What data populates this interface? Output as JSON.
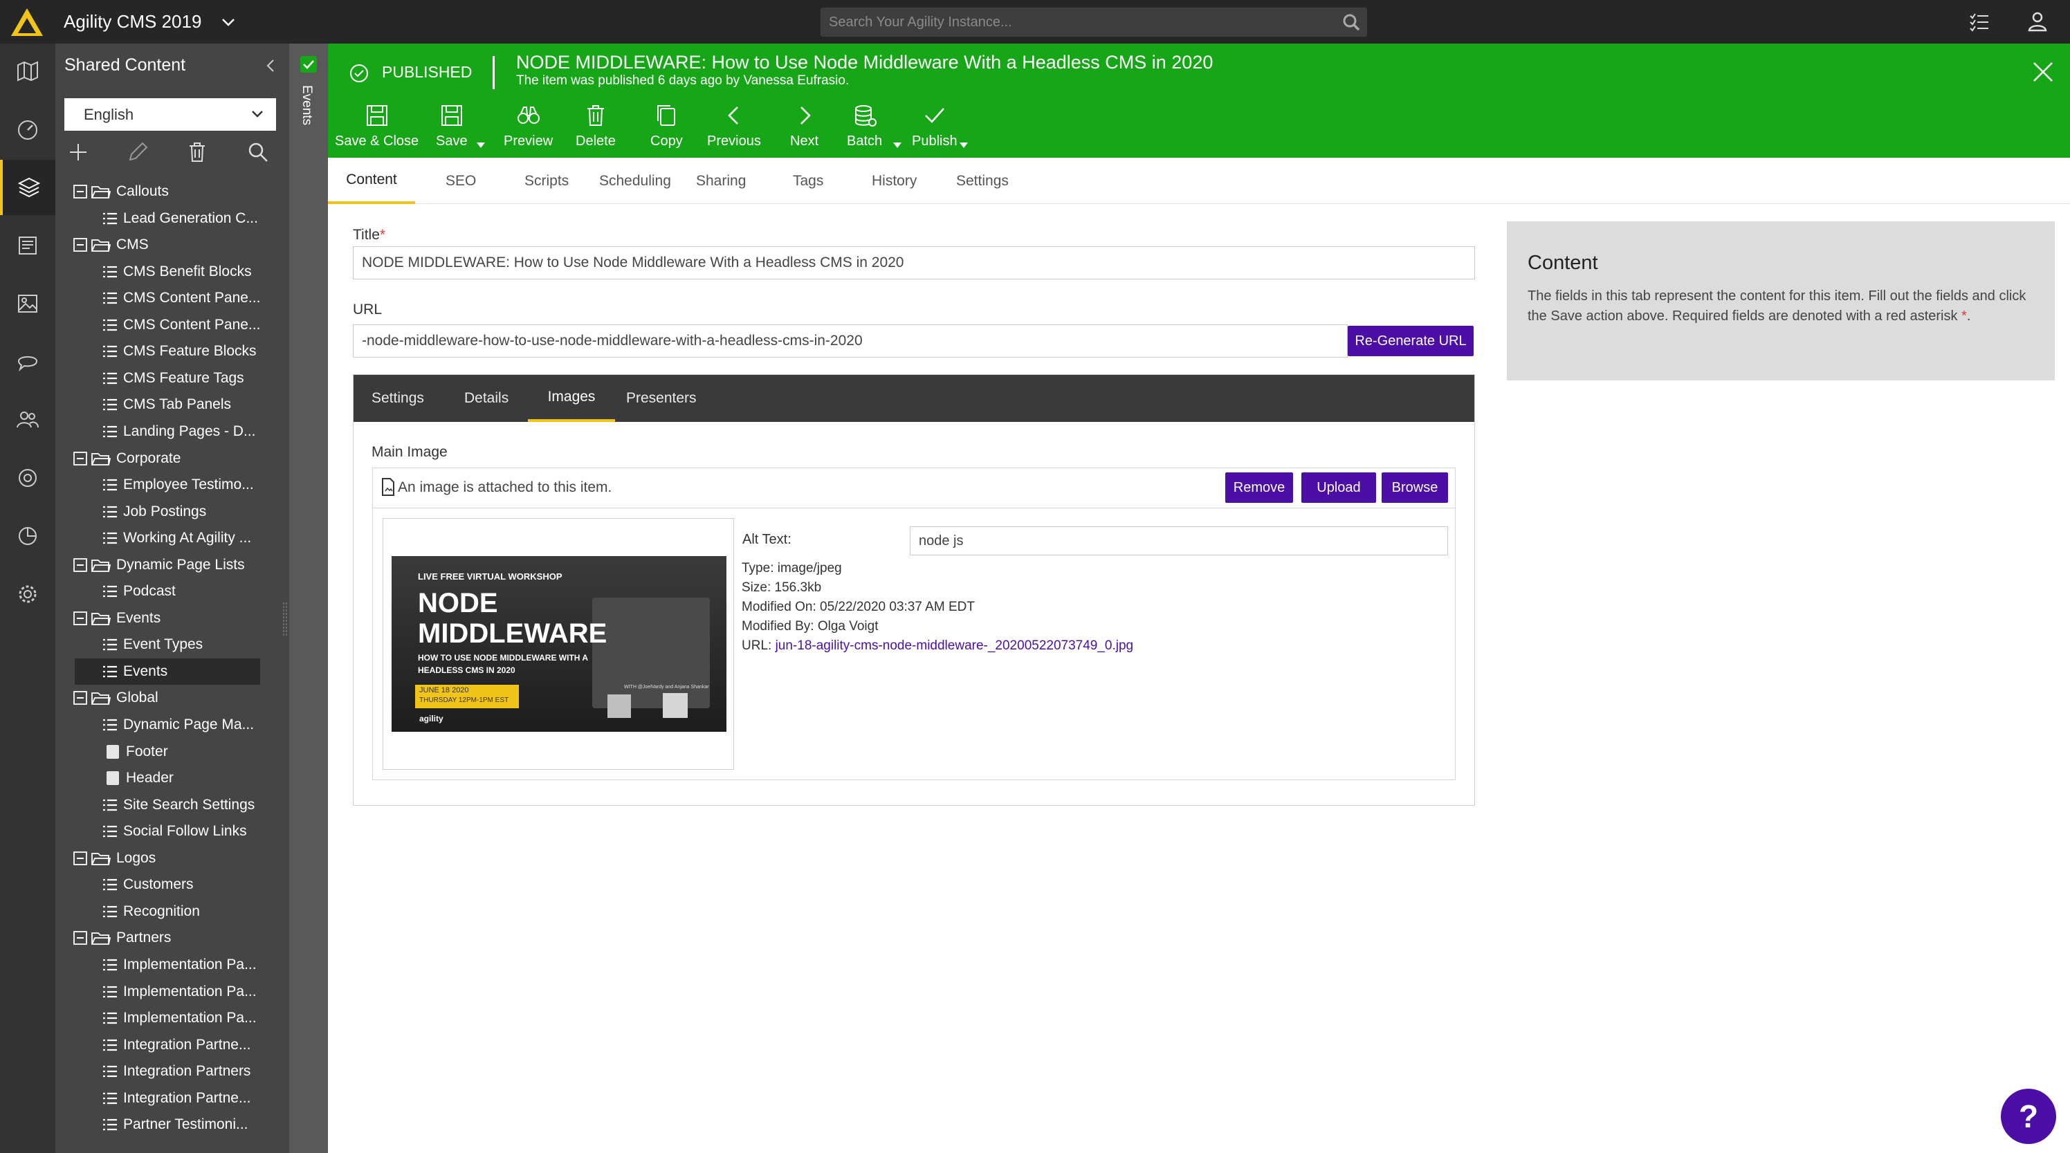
{
  "app": {
    "title": "Agility CMS 2019"
  },
  "search": {
    "placeholder": "Search Your Agility Instance..."
  },
  "tree": {
    "title": "Shared Content",
    "language": "English",
    "nodes": [
      {
        "label": "Callouts",
        "kind": "folder"
      },
      {
        "label": "Lead Generation C...",
        "kind": "list"
      },
      {
        "label": "CMS",
        "kind": "folder"
      },
      {
        "label": "CMS Benefit Blocks",
        "kind": "list"
      },
      {
        "label": "CMS Content Pane...",
        "kind": "list"
      },
      {
        "label": "CMS Content Pane...",
        "kind": "list"
      },
      {
        "label": "CMS Feature Blocks",
        "kind": "list"
      },
      {
        "label": "CMS Feature Tags",
        "kind": "list"
      },
      {
        "label": "CMS Tab Panels",
        "kind": "list"
      },
      {
        "label": "Landing Pages - D...",
        "kind": "list"
      },
      {
        "label": "Corporate",
        "kind": "folder"
      },
      {
        "label": "Employee Testimo...",
        "kind": "list"
      },
      {
        "label": "Job Postings",
        "kind": "list"
      },
      {
        "label": "Working At Agility ...",
        "kind": "list"
      },
      {
        "label": "Dynamic Page Lists",
        "kind": "folder"
      },
      {
        "label": "Podcast",
        "kind": "list"
      },
      {
        "label": "Events",
        "kind": "folder"
      },
      {
        "label": "Event Types",
        "kind": "list"
      },
      {
        "label": "Events",
        "kind": "list",
        "selected": true
      },
      {
        "label": "Global",
        "kind": "folder"
      },
      {
        "label": "Dynamic Page Ma...",
        "kind": "list"
      },
      {
        "label": "Footer",
        "kind": "page"
      },
      {
        "label": "Header",
        "kind": "page"
      },
      {
        "label": "Site Search Settings",
        "kind": "list"
      },
      {
        "label": "Social Follow Links",
        "kind": "list"
      },
      {
        "label": "Logos",
        "kind": "folder"
      },
      {
        "label": "Customers",
        "kind": "list"
      },
      {
        "label": "Recognition",
        "kind": "list"
      },
      {
        "label": "Partners",
        "kind": "folder"
      },
      {
        "label": "Implementation Pa...",
        "kind": "list"
      },
      {
        "label": "Implementation Pa...",
        "kind": "list"
      },
      {
        "label": "Implementation Pa...",
        "kind": "list"
      },
      {
        "label": "Integration Partne...",
        "kind": "list"
      },
      {
        "label": "Integration Partners",
        "kind": "list"
      },
      {
        "label": "Integration Partne...",
        "kind": "list"
      },
      {
        "label": "Partner Testimoni...",
        "kind": "list"
      }
    ]
  },
  "side_strip": {
    "label": "Events"
  },
  "item": {
    "status": "PUBLISHED",
    "title": "NODE MIDDLEWARE: How to Use Node Middleware With a Headless CMS in 2020",
    "subtitle": "The item was published 6 days ago by Vanessa Eufrasio."
  },
  "toolbar": {
    "save_close": "Save & Close",
    "save": "Save",
    "preview": "Preview",
    "delete": "Delete",
    "copy": "Copy",
    "previous": "Previous",
    "next": "Next",
    "batch": "Batch",
    "publish": "Publish"
  },
  "tabs": [
    "Content",
    "SEO",
    "Scripts",
    "Scheduling",
    "Sharing",
    "Tags",
    "History",
    "Settings"
  ],
  "form": {
    "title_label": "Title",
    "title_required": "*",
    "title_value": "NODE MIDDLEWARE: How to Use Node Middleware With a Headless CMS in 2020",
    "url_label": "URL",
    "url_value": "-node-middleware-how-to-use-node-middleware-with-a-headless-cms-in-2020",
    "regen_label": "Re-Generate URL"
  },
  "inner_tabs": [
    "Settings",
    "Details",
    "Images",
    "Presenters"
  ],
  "image_field": {
    "label": "Main Image",
    "attached_text": "An image is attached to this item.",
    "remove": "Remove",
    "upload": "Upload",
    "browse": "Browse",
    "alt_label": "Alt Text:",
    "alt_value": "node js",
    "type_label": "Type:",
    "type_value": "image/jpeg",
    "size_label": "Size:",
    "size_value": "156.3kb",
    "modified_on_label": "Modified On:",
    "modified_on_value": "05/22/2020 03:37 AM EDT",
    "modified_by_label": "Modified By:",
    "modified_by_value": "Olga Voigt",
    "url_label": "URL:",
    "url_value": "jun-18-agility-cms-node-middleware-_20200522073749_0.jpg"
  },
  "thumbnail": {
    "kicker": "LIVE FREE VIRTUAL WORKSHOP",
    "line1": "NODE",
    "line2": "MIDDLEWARE",
    "sub1": "HOW TO USE NODE MIDDLEWARE WITH A",
    "sub2": "HEADLESS CMS IN 2020",
    "date1": "JUNE 18 2020",
    "date2": "THURSDAY 12PM-1PM EST",
    "with": "WITH @JoelVardy and Anjana Shankar",
    "brand": "agility"
  },
  "help": {
    "title": "Content",
    "text": "The fields in this tab represent the content for this item.  Fill out the fields and click the Save action above.  Required fields are denoted with a red asterisk",
    "asterisk": "*",
    "period": "."
  },
  "help_fab": "?",
  "colors": {
    "accent_green": "#17a617",
    "brand_purple": "#4b0fa6",
    "highlight_yellow": "#f0c419"
  }
}
